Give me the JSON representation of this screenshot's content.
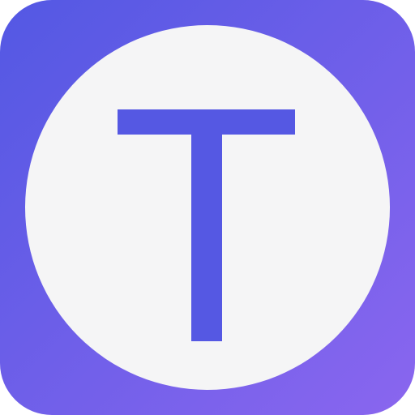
{
  "icon": {
    "letter": "T",
    "colors": {
      "gradient_start": "#5358e3",
      "gradient_end": "#8a66ef",
      "circle": "#f5f5f6",
      "letter": "#5558e3"
    }
  }
}
